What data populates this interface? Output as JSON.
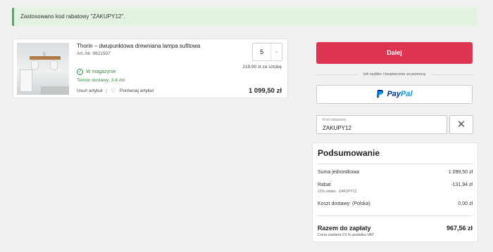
{
  "notice": {
    "text": "Zastosowano kod rabatowy \"ZAKUPY12\"."
  },
  "cart": {
    "item": {
      "image_alt": "ceiling-lamp-photo",
      "title": "Thorin – dwupunktowa drewniana lampa sufitowa",
      "sku": "Art.-Nr. 9621507",
      "quantity": "5",
      "unit_price": "219,90 zł za sztukę",
      "stock": "W magazynie",
      "delivery": "Termin dostawy: 3-6 dni",
      "remove_label": "Usuń artykuł",
      "separator": "|",
      "compare_label": "Porównaj artykuł",
      "line_total": "1 099,50 zł"
    }
  },
  "checkout": {
    "button_label": "Dalej",
    "divider_text": "lub szybko i bezpiecznie za pomocą",
    "paypal_word_a": "Pay",
    "paypal_word_b": "Pal"
  },
  "coupon": {
    "label": "Kod rabatowy",
    "value": "ZAKUPY12"
  },
  "summary": {
    "title": "Podsumowanie",
    "rows": [
      {
        "label": "Suma jednostkowa",
        "value": "1 099,50 zł"
      },
      {
        "label": "Rabat",
        "value": "-131,94 zł",
        "sub": "12% rabatu - ZAKUPY12"
      },
      {
        "label": "Koszt dostawy: (Polska)",
        "value": "0,00 zł"
      }
    ],
    "total_label": "Razem do zapłaty",
    "total_value": "967,56 zł",
    "vat_note": "Cena zawiera 23 % podatku VAT"
  },
  "colors": {
    "accent": "#dd3452",
    "notice_bg": "#e3f2e1",
    "in_stock": "#2e8a3d",
    "paypal_dark": "#003087",
    "paypal_light": "#009cde"
  },
  "icons": [
    "check-circle-icon",
    "heart-icon",
    "chevron-down-icon",
    "paypal-icon",
    "close-icon"
  ]
}
